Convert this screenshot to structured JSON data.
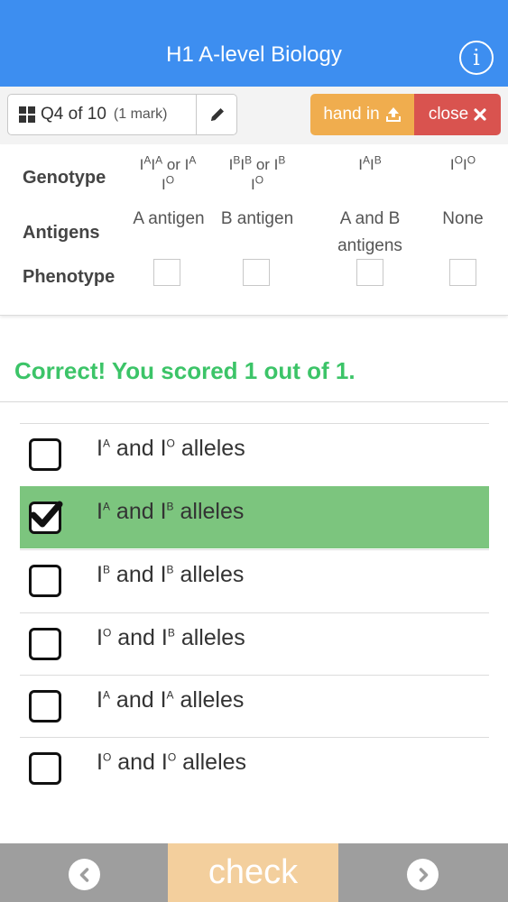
{
  "app": {
    "title": "H1 A-level Biology"
  },
  "toolbar": {
    "question_label": "Q4 of 10",
    "mark_label": "(1 mark)",
    "hand_in_label": "hand in",
    "close_label": "close"
  },
  "table": {
    "row_labels": {
      "genotype": "Genotype",
      "antigens": "Antigens",
      "phenotype": "Phenotype"
    },
    "columns": [
      {
        "genotype": "IAIA or IAIO",
        "antigens": "A antigen"
      },
      {
        "genotype": "IBIB or IBIO",
        "antigens": "B antigen"
      },
      {
        "genotype": "IAIB",
        "antigens": "A and B antigens"
      },
      {
        "genotype": "IOIO",
        "antigens": "None"
      }
    ]
  },
  "result": {
    "message": "Correct! You scored 1 out of 1."
  },
  "options": [
    {
      "text": "IA and IO alleles",
      "checked": false
    },
    {
      "text": "IA and IB alleles",
      "checked": true
    },
    {
      "text": "IB and IB alleles",
      "checked": false
    },
    {
      "text": "IO and IB alleles",
      "checked": false
    },
    {
      "text": "IA and IA alleles",
      "checked": false
    },
    {
      "text": "IO and IO alleles",
      "checked": false
    }
  ],
  "footer": {
    "check_label": "check"
  },
  "colors": {
    "header": "#3d8ef0",
    "hand_in": "#f0ad4e",
    "close": "#d9534f",
    "correct_text": "#3cc468",
    "selected_option": "#7cc57e",
    "check_button": "#f3cf9d",
    "footer": "#9e9e9e"
  },
  "icons": {
    "info": "info-icon",
    "grid": "grid-icon",
    "edit": "pencil-icon",
    "upload": "upload-icon",
    "close": "close-icon",
    "checkmark": "checkmark-icon",
    "prev": "chevron-left-icon",
    "next": "chevron-right-icon"
  }
}
